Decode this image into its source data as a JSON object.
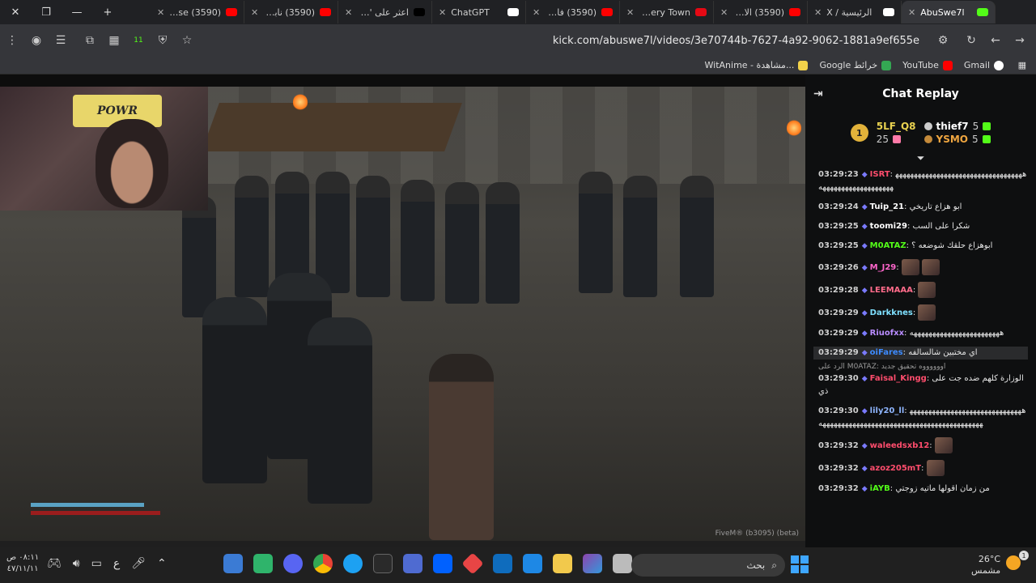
{
  "tabs": [
    {
      "title": "(3590) Youse",
      "favicon_color": "#ff0000"
    },
    {
      "title": "(3590) نابولي",
      "favicon_color": "#ff0000"
    },
    {
      "title": "اعثر على 'سير",
      "favicon_color": "#000000"
    },
    {
      "title": "ChatGPT",
      "favicon_color": "#ffffff"
    },
    {
      "title": "(3590) فاجأونا",
      "favicon_color": "#ff0000"
    },
    {
      "title": "Mystery Town",
      "favicon_color": "#e50914"
    },
    {
      "title": "(3590) الاعداد",
      "favicon_color": "#ff0000"
    },
    {
      "title": "الرئيسية / X",
      "favicon_color": "#ffffff"
    },
    {
      "title": "AbuSwe7l",
      "favicon_color": "#53fc18"
    }
  ],
  "address": {
    "url": "kick.com/abuswe7l/videos/3e70744b-7627-4a92-9062-1881a9ef655e",
    "extension_badge": "11"
  },
  "bookmarks": [
    {
      "label": "WitAnime - مشاهدة...",
      "color": "#f2d24a"
    },
    {
      "label": "Google خرائط",
      "color": "#34a853"
    },
    {
      "label": "YouTube",
      "color": "#ff0000"
    },
    {
      "label": "Gmail",
      "color": "#ffffff"
    }
  ],
  "video": {
    "webcam_sign": "POWR",
    "footer": "FiveM® (b3095) (beta)"
  },
  "chat": {
    "title": "Chat Replay",
    "leaderboard": {
      "first": {
        "rank": "1",
        "name": "5LF_Q8",
        "count": "25"
      },
      "second": {
        "name": "thief7",
        "count": "5"
      },
      "third": {
        "name": "YSMO",
        "count": "5"
      }
    },
    "messages": [
      {
        "time": "03:29:23",
        "user": "ISRT",
        "color": "#ff4d6d",
        "text": "ههههههههههههههههههههههههههههههههههههههههههههههههههههههه"
      },
      {
        "time": "03:29:24",
        "user": "Tuip_21",
        "color": "#ffffff",
        "text": "ابو هزاع تاريخي"
      },
      {
        "time": "03:29:25",
        "user": "toomi29",
        "color": "#ffffff",
        "text": "شكرا على السب"
      },
      {
        "time": "03:29:25",
        "user": "M0ATAZ",
        "color": "#53fc18",
        "text": "ابوهزاع حلقك شوضعه ؟"
      },
      {
        "time": "03:29:26",
        "user": "M_J29",
        "color": "#ff66cc",
        "text": ""
      },
      {
        "time": "03:29:28",
        "user": "LEEMAAA",
        "color": "#ff6b8a",
        "text": ""
      },
      {
        "time": "03:29:29",
        "user": "Darkknes",
        "color": "#7fe0ff",
        "text": ""
      },
      {
        "time": "03:29:29",
        "user": "Riuofxx",
        "color": "#b98cff",
        "text": "ههههههههههههههههههههههههه"
      },
      {
        "time": "03:29:29",
        "user": "oiFares",
        "color": "#3d8bff",
        "text": "اي مختبين شالسالفه"
      },
      {
        "time": "03:29:30",
        "user": "Faisal_Kingg",
        "color": "#ff4d6d",
        "text": "الوزارة كلهم ضده جت على ذي",
        "reply": "الرد على M0ATAZ: اووووووه تحقيق جديد"
      },
      {
        "time": "03:29:30",
        "user": "lily20_ll",
        "color": "#8fb6ff",
        "text": "ههههههههههههههههههههههههههههههههههههههههههههههههههههههههههههههههههههههههههه"
      },
      {
        "time": "03:29:32",
        "user": "waleedsxb12",
        "color": "#ff4d6d",
        "text": ""
      },
      {
        "time": "03:29:32",
        "user": "azoz205mT",
        "color": "#ff4d6d",
        "text": ""
      },
      {
        "time": "03:29:32",
        "user": "iAYB",
        "color": "#53fc18",
        "text": "من زمان اقولها ماتيه زوجتي"
      }
    ]
  },
  "taskbar": {
    "clock_time": "٠٨:١١ ص",
    "clock_date": "٤٧/١١/١١",
    "lang": "ع",
    "search_placeholder": "بحث",
    "temperature": "26°C",
    "weather": "مشمس",
    "notification_count": "1"
  }
}
